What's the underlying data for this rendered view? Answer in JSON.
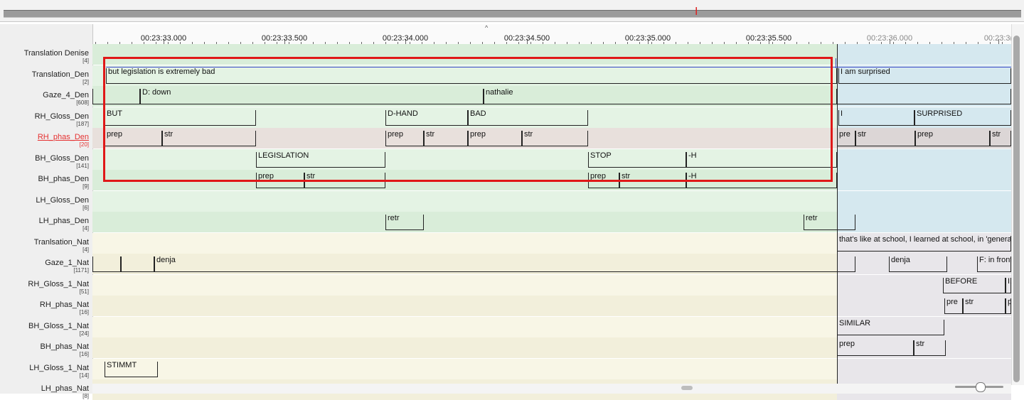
{
  "ruler": {
    "labels": [
      "00:23:33.000",
      "00:23:33.500",
      "00:23:34.000",
      "00:23:34.500",
      "00:23:35.000",
      "00:23:35.500",
      "00:23:36.000",
      "00:23:3("
    ]
  },
  "tiers": [
    {
      "name": "Translation Denise",
      "count": "[4]",
      "highlight": false
    },
    {
      "name": "Translation_Den",
      "count": "[2]",
      "highlight": false
    },
    {
      "name": "Gaze_4_Den",
      "count": "[608]",
      "highlight": false
    },
    {
      "name": "RH_Gloss_Den",
      "count": "[187]",
      "highlight": false
    },
    {
      "name": "RH_phas_Den",
      "count": "[20]",
      "highlight": true
    },
    {
      "name": "BH_Gloss_Den",
      "count": "[141]",
      "highlight": false
    },
    {
      "name": "BH_phas_Den",
      "count": "[9]",
      "highlight": false
    },
    {
      "name": "LH_Gloss_Den",
      "count": "[6]",
      "highlight": false
    },
    {
      "name": "LH_phas_Den",
      "count": "[4]",
      "highlight": false
    },
    {
      "name": "Tranlsation_Nat",
      "count": "[4]",
      "highlight": false
    },
    {
      "name": "Gaze_1_Nat",
      "count": "[1171]",
      "highlight": false
    },
    {
      "name": "RH_Gloss_1_Nat",
      "count": "[51]",
      "highlight": false
    },
    {
      "name": "RH_phas_Nat",
      "count": "[16]",
      "highlight": false
    },
    {
      "name": "BH_Gloss_1_Nat",
      "count": "[24]",
      "highlight": false
    },
    {
      "name": "BH_phas_Nat",
      "count": "[16]",
      "highlight": false
    },
    {
      "name": "LH_Gloss_1_Nat",
      "count": "[14]",
      "highlight": false
    },
    {
      "name": "LH_phas_Nat",
      "count": "[8]",
      "highlight": false
    }
  ],
  "annotations": {
    "translation_den_1": "but legislation is extremely bad",
    "translation_den_2": "I am surprised",
    "gaze_1": "D: down",
    "gaze_2": "nathalie",
    "rh_gloss_1": "BUT",
    "rh_gloss_2": "D-HAND",
    "rh_gloss_3": "BAD",
    "rh_gloss_4": "I",
    "rh_gloss_5": "SURPRISED",
    "rh_phas": [
      "prep",
      "str",
      "prep",
      "str",
      "prep",
      "str",
      "pre",
      "str",
      "prep",
      "str"
    ],
    "bh_gloss_1": "LEGISLATION",
    "bh_gloss_2": "STOP",
    "bh_gloss_3": "-H",
    "bh_phas": [
      "prep",
      "str",
      "prep",
      "str",
      "-H"
    ],
    "lh_phas": [
      "retr",
      "retr"
    ],
    "translation_nat": "that's like at school, I learned at school, in 'genera",
    "gaze_nat": [
      "denja",
      "denja",
      "F: in front"
    ],
    "rh_gloss_nat_1": "BEFORE",
    "rh_gloss_nat_2": "I.",
    "rh_phas_nat": [
      "pre",
      "str",
      "p"
    ],
    "bh_gloss_nat": "SIMILAR",
    "bh_phas_nat": [
      "prep",
      "str"
    ],
    "lh_gloss_nat": "STIMMT"
  },
  "colors": {
    "den_row": "#e4f3e4",
    "den_row_alt": "#d9edd9",
    "nat_row": "#f8f6e6",
    "nat_row_alt": "#f2efdb",
    "highlight_row": "#e8e0dc",
    "right_den": "#d5e8ef",
    "right_nat": "#e8e6ea",
    "selection": "#e01818"
  }
}
